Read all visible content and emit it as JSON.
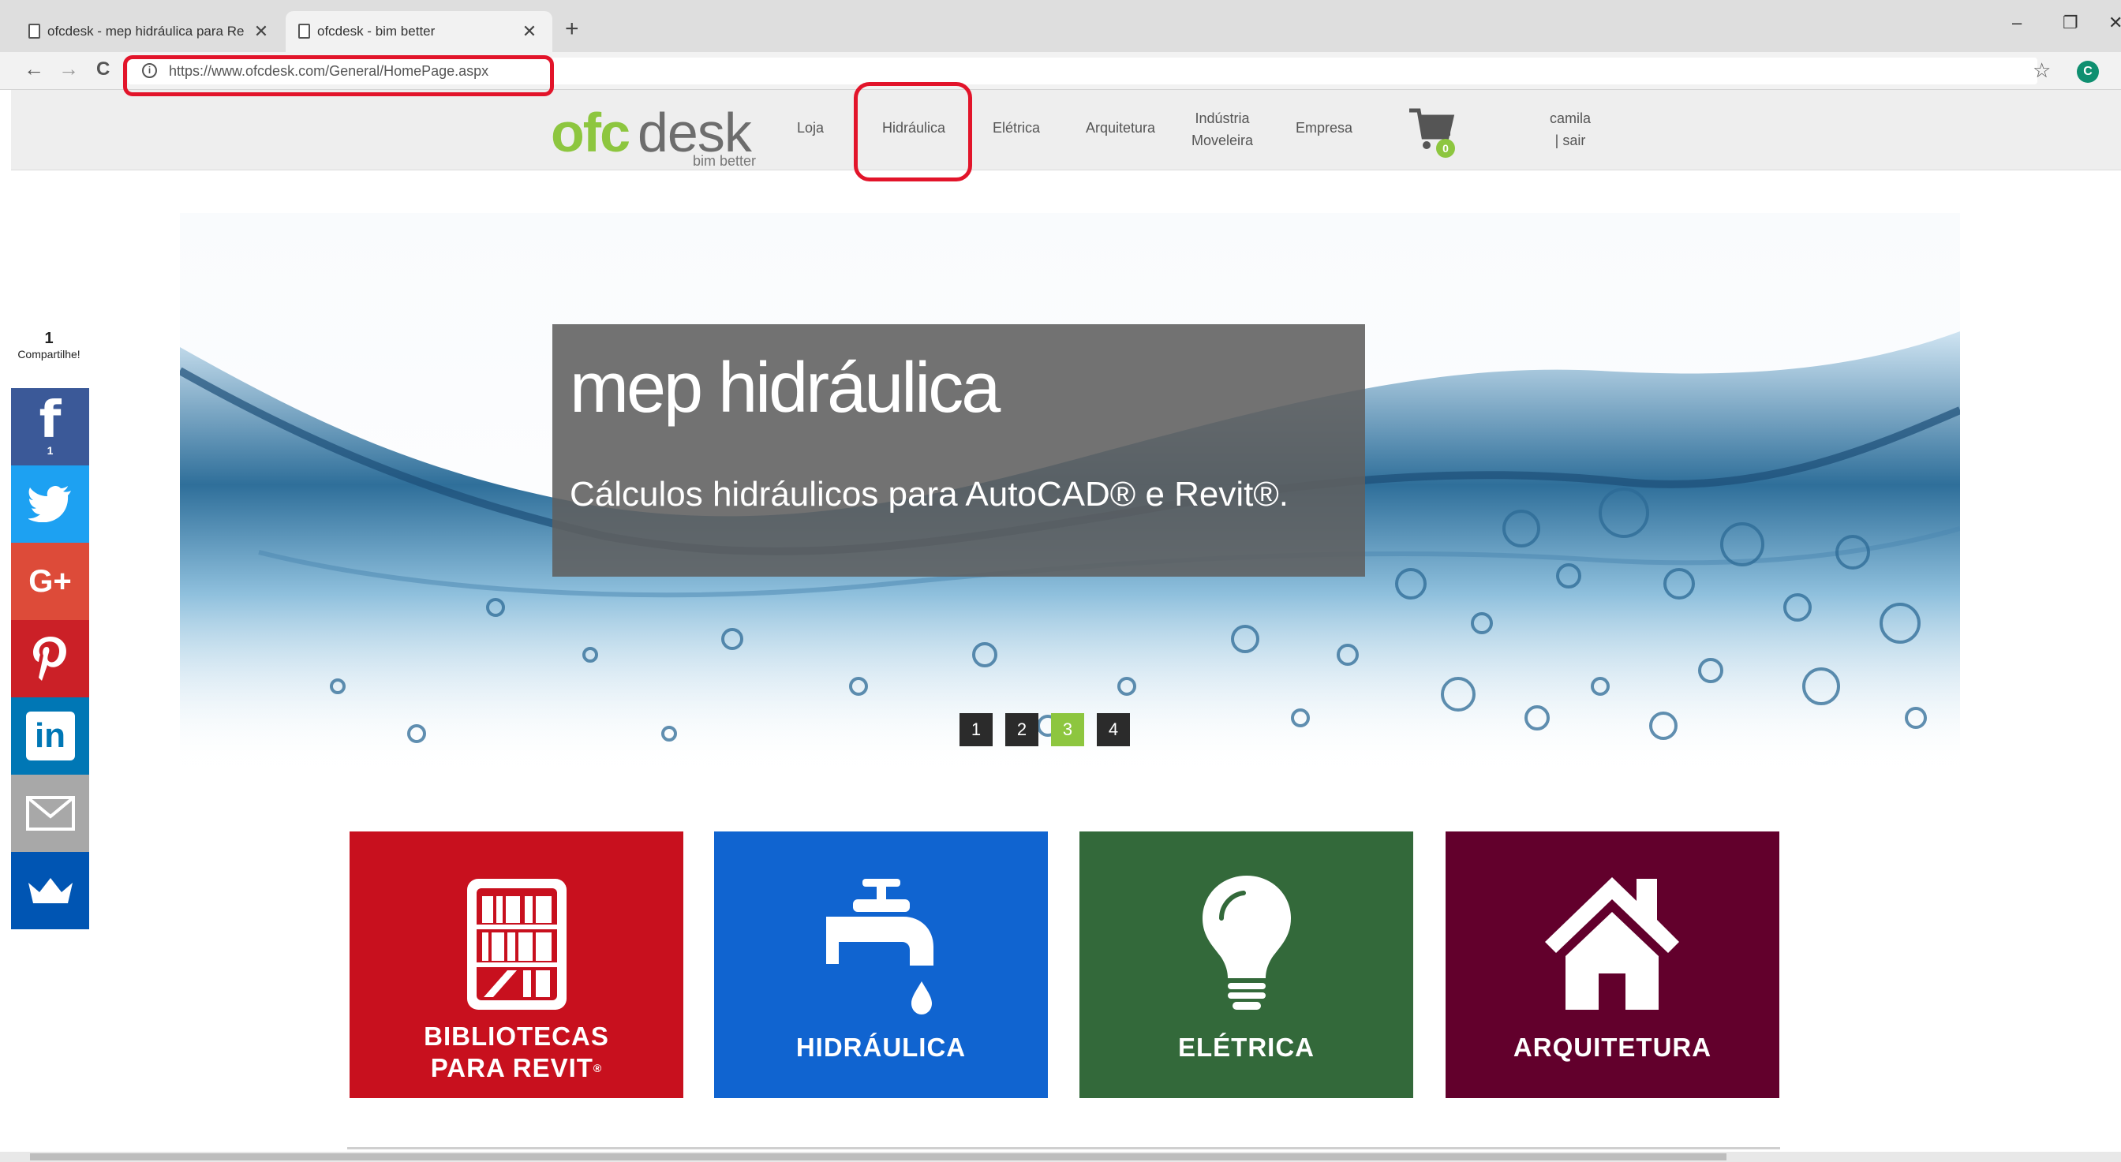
{
  "browser": {
    "tabs": [
      {
        "title": "ofcdesk - mep hidráulica para Re",
        "close": "✕"
      },
      {
        "title": "ofcdesk - bim better",
        "close": "✕"
      }
    ],
    "new_tab": "+",
    "window_controls": {
      "minimize": "–",
      "restore": "❐",
      "close": "✕"
    },
    "nav": {
      "back": "←",
      "forward": "→",
      "reload": "C"
    },
    "url": "https://www.ofcdesk.com/General/HomePage.aspx",
    "info_icon": "i",
    "bookmark_icon": "☆",
    "profile_initial": "C"
  },
  "header": {
    "logo": {
      "part1": "ofc",
      "part2": "desk",
      "tagline": "bim better"
    },
    "nav": {
      "loja": "Loja",
      "hidraulica": "Hidráulica",
      "eletrica": "Elétrica",
      "arquitetura": "Arquitetura",
      "industria_line1": "Indústria",
      "industria_line2": "Moveleira",
      "empresa": "Empresa"
    },
    "cart_count": "0",
    "user": {
      "name": "camila",
      "logout": "| sair"
    }
  },
  "share": {
    "count": "1",
    "label": "Compartilhe!",
    "facebook_count": "1",
    "buttons": [
      {
        "name": "facebook",
        "color": "#3b5998"
      },
      {
        "name": "twitter",
        "color": "#1da1f2"
      },
      {
        "name": "google-plus",
        "color": "#dd4b39"
      },
      {
        "name": "pinterest",
        "color": "#cb2027"
      },
      {
        "name": "linkedin",
        "color": "#0077b5"
      },
      {
        "name": "email",
        "color": "#a8a8a8"
      },
      {
        "name": "crown",
        "color": "#0055b3"
      }
    ]
  },
  "hero": {
    "title": "mep hidráulica",
    "subtitle": "Cálculos hidráulicos para AutoCAD® e Revit®.",
    "slides": [
      "1",
      "2",
      "3",
      "4"
    ],
    "active_slide": "3"
  },
  "tiles": [
    {
      "line1": "BIBLIOTECAS",
      "line2": "PARA REVIT",
      "mark": "®",
      "color": "#c8101e",
      "icon": "books-icon"
    },
    {
      "line1": "HIDRÁULICA",
      "color": "#1064d0",
      "icon": "faucet-icon"
    },
    {
      "line1": "ELÉTRICA",
      "color": "#33693a",
      "icon": "lightbulb-icon"
    },
    {
      "line1": "ARQUITETURA",
      "color": "#62002c",
      "icon": "house-icon"
    }
  ],
  "colors": {
    "brand_green": "#8dc63f",
    "annotation_red": "#e2142a"
  }
}
